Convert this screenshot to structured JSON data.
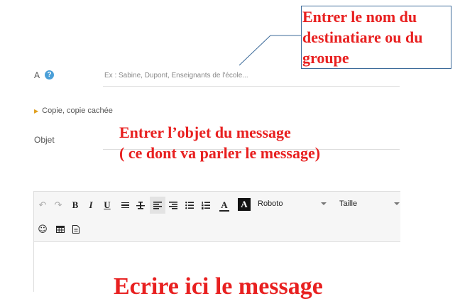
{
  "to": {
    "label": "A",
    "help_icon": "?",
    "placeholder": "Ex : Sabine, Dupont, Enseignants de l'école..."
  },
  "cc": {
    "label": "Copie, copie cachée",
    "arrow_icon": "▶"
  },
  "subject": {
    "label": "Objet"
  },
  "annotations": {
    "recipient": [
      "Entrer le nom du",
      "destinatiare ou du",
      "groupe"
    ],
    "subject": [
      "Entrer l’objet du message",
      "( ce dont va parler le message)"
    ],
    "body": "Ecrire ici le message"
  },
  "toolbar": {
    "undo_icon": "↶",
    "redo_icon": "↷",
    "bold": "B",
    "italic": "I",
    "underline": "U",
    "font_color": "A",
    "background_color": "A",
    "font_family": "Roboto",
    "font_size": "Taille",
    "emoji_icon": "☺",
    "table_icon": "▦",
    "attachment_icon": "🗎"
  },
  "colors": {
    "annotation_red": "#e82020",
    "help_blue": "#4a9fd8",
    "arrow_orange": "#e0a020",
    "annotation_border": "#3d6b9a"
  }
}
